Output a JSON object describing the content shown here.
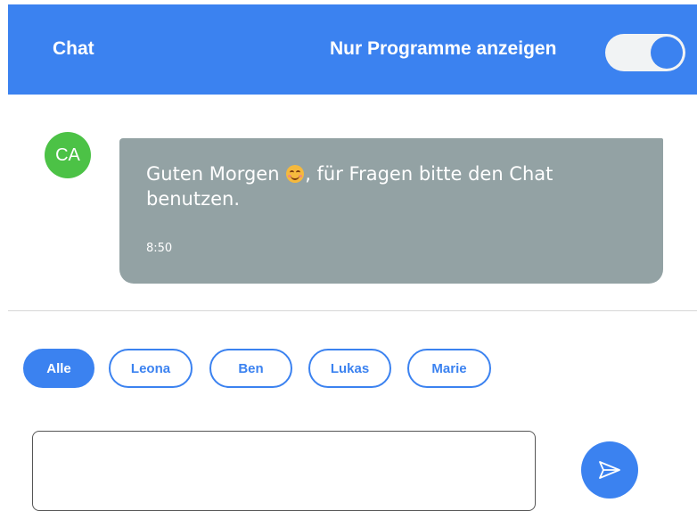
{
  "header": {
    "title": "Chat",
    "toggle_label": "Nur Programme anzeigen",
    "toggle_on": true
  },
  "messages": [
    {
      "avatar_initials": "CA",
      "avatar_color": "#4cc246",
      "text_before_emoji": "Guten Morgen ",
      "emoji": "smiling-face-icon",
      "text_after_emoji": ", für Fragen bitte den Chat benutzen.",
      "time": "8:50"
    }
  ],
  "filters": {
    "chips": [
      "Alle",
      "Leona",
      "Ben",
      "Lukas",
      "Marie"
    ],
    "active": "Alle"
  },
  "composer": {
    "value": "",
    "send_icon": "send-icon"
  },
  "colors": {
    "accent": "#3b82f0",
    "bubble": "#93a2a4",
    "avatar": "#4cc246"
  }
}
